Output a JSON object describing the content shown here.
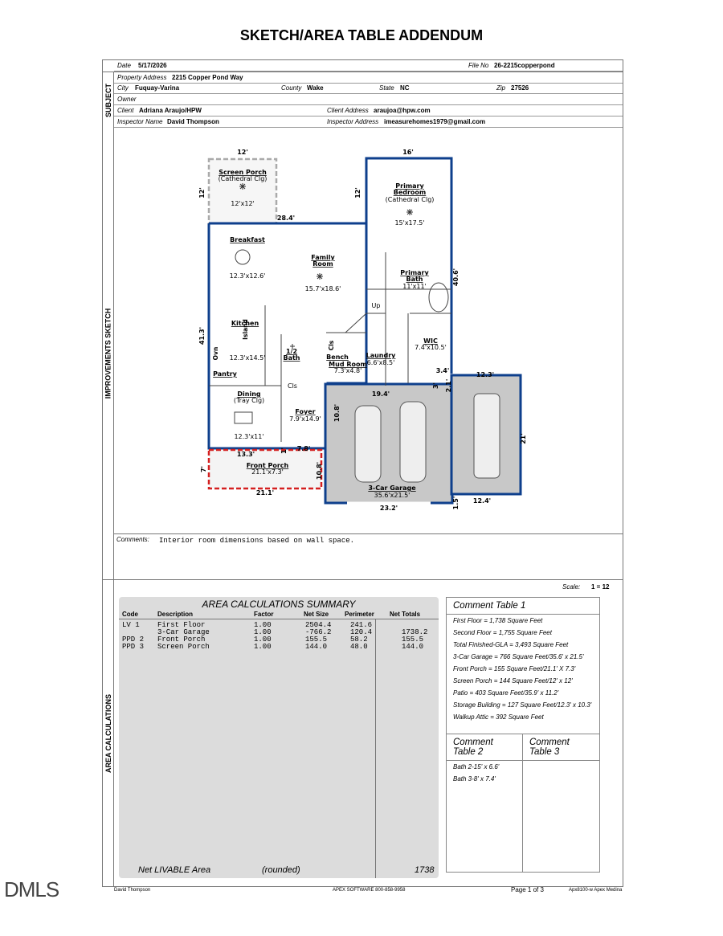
{
  "title": "SKETCH/AREA TABLE ADDENDUM",
  "header": {
    "date_label": "Date",
    "date": "5/17/2026",
    "file_label": "File No",
    "file": "26-2215copperpond",
    "address_label": "Property Address",
    "address": "2215 Copper Pond Way",
    "city_label": "City",
    "city": "Fuquay-Varina",
    "county_label": "County",
    "county": "Wake",
    "state_label": "State",
    "state": "NC",
    "zip_label": "Zip",
    "zip": "27526",
    "owner_label": "Owner",
    "owner": "",
    "client_label": "Client",
    "client": "Adriana Araujo/HPW",
    "client_addr_label": "Client Address",
    "client_addr": "araujoa@hpw.com",
    "inspector_label": "Inspector Name",
    "inspector": "David Thompson",
    "inspector_addr_label": "Inspector Address",
    "inspector_addr": "imeasurehomes1979@gmail.com"
  },
  "sections": {
    "subject": "SUBJECT",
    "sketch": "IMPROVEMENTS SKETCH",
    "area": "AREA CALCULATIONS"
  },
  "sketch": {
    "screen_porch": "Screen Porch",
    "screen_porch_sub": "(Cathedral Clg)",
    "screen_porch_dim": "12'x12'",
    "primary_bedroom": "Primary Bedroom",
    "primary_bedroom_l1": "Primary",
    "primary_bedroom_l2": "Bedroom",
    "primary_bedroom_sub": "(Cathedral Clg)",
    "primary_bedroom_dim": "15'x17.5'",
    "breakfast": "Breakfast",
    "breakfast_dim": "12.3'x12.6'",
    "family_l1": "Family",
    "family_l2": "Room",
    "family_dim": "15.7'x18.6'",
    "primary_bath_l1": "Primary",
    "primary_bath_l2": "Bath",
    "primary_bath_dim": "11'x11'",
    "kitchen": "Kitchen",
    "kitchen_dim": "12.3'x14.5'",
    "island": "Island",
    "ovn": "Ovn",
    "half_bath_l1": "1/2",
    "half_bath_l2": "Bath",
    "cls": "Cls",
    "up": "Up",
    "wic": "WIC",
    "wic_dim": "7.4'x10.5'",
    "bench": "Bench",
    "laundry": "Laundry",
    "laundry_dim": "6.6'x8.5'",
    "mud_room": "Mud Room",
    "mud_dim": "7.3'x4.8'",
    "pantry": "Pantry",
    "dining": "Dining",
    "dining_sub": "(Tray Clg)",
    "dining_dim": "12.3'x11'",
    "foyer": "Foyer",
    "foyer_dim": "7.9'x14.9'",
    "front_porch": "Front Porch",
    "front_porch_dim": "21.1'x7.3'",
    "garage": "3-Car Garage",
    "garage_dim": "35.6'x21.5'",
    "d12a": "12'",
    "d12b": "12'",
    "d16": "16'",
    "d12c": "12'",
    "d284": "28.4'",
    "d406": "40.6'",
    "d413": "41.3'",
    "d194": "19.4'",
    "d108a": "10.8'",
    "d123": "12.3'",
    "d34": "3.4'",
    "d3": "3'",
    "d21a": "2.1'",
    "d21b": "21'",
    "d133": "13.3'",
    "d78": "7.8'",
    "d1": "1'",
    "d7": "7'",
    "d108b": "10.8'",
    "d211": "21.1'",
    "d232": "23.2'",
    "d15": "1.5'",
    "d124": "12.4'"
  },
  "comments": {
    "label": "Comments:",
    "text": "Interior room dimensions based on wall space."
  },
  "scale": {
    "label": "Scale:",
    "value": "1 = 12"
  },
  "area_summary": {
    "title": "AREA CALCULATIONS SUMMARY",
    "columns": [
      "Code",
      "Description",
      "Factor",
      "Net Size",
      "Perimeter",
      "Net Totals"
    ],
    "rows": [
      [
        "LV 1",
        "First Floor",
        "1.00",
        "2504.4",
        "241.6",
        ""
      ],
      [
        "",
        "3-Car Garage",
        "1.00",
        "-766.2",
        "120.4",
        "1738.2"
      ],
      [
        "PPD 2",
        "Front Porch",
        "1.00",
        "155.5",
        "58.2",
        "155.5"
      ],
      [
        "PPD 3",
        "Screen Porch",
        "1.00",
        "144.0",
        "48.0",
        "144.0"
      ]
    ],
    "net_label": "Net LIVABLE Area",
    "rounded": "(rounded)",
    "net_value": "1738"
  },
  "comment_table_1": {
    "title": "Comment Table 1",
    "lines": [
      "First Floor = 1,738 Square Feet",
      "Second Floor = 1,755 Square Feet",
      "Total Finished-GLA = 3,493 Square Feet",
      "3-Car Garage = 766 Square Feet/35.6' x 21.5'",
      "Front Porch = 155 Square Feet/21.1' X 7.3'",
      "Screen Porch = 144 Square Feet/12' x 12'",
      "Patio = 403 Square Feet/35.9' x 11.2'",
      "Storage Building = 127 Square Feet/12.3' x 10.3'",
      "Walkup Attic = 392 Square Feet"
    ]
  },
  "comment_table_2": {
    "title": "Comment Table 2",
    "lines": [
      "Bath 2-15' x 6.6'",
      "Bath 3-8' x 7.4'"
    ]
  },
  "comment_table_3": {
    "title": "Comment Table 3"
  },
  "footer": {
    "left": "David Thompson",
    "center": "APEX SOFTWARE 800-858-9958",
    "page": "Page 1 of 3",
    "right": "Apx8100-w Apex Medina"
  },
  "watermark": "DMLS",
  "colors": {
    "wall": "#0e3f8c",
    "garage_fill": "#c8c8c8",
    "porch_dash": "#d42020",
    "screen_dash": "#aaaaaa",
    "summary_bg": "#dcdcdc"
  }
}
